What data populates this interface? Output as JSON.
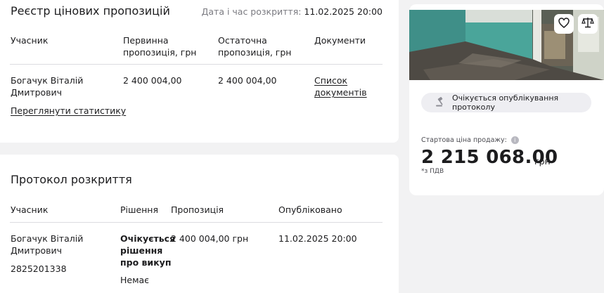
{
  "registry": {
    "title": "Реєстр цінових пропозицій",
    "date_label": "Дата і час розкриття:",
    "date_value": "11.02.2025 20:00",
    "headers": {
      "participant": "Учасник",
      "initial_line1": "Первинна",
      "initial_line2": "пропозиція, грн",
      "final_line1": "Остаточна",
      "final_line2": "пропозиція, грн",
      "documents": "Документи"
    },
    "row": {
      "name_line1": "Богачук Віталій",
      "name_line2": "Дмитрович",
      "initial": "2 400 004,00",
      "final": "2 400 004,00",
      "docs_line1": "Список",
      "docs_line2": "документів"
    },
    "stats_link": "Переглянути статистику"
  },
  "protocol": {
    "title": "Протокол розкриття",
    "headers": {
      "participant": "Учасник",
      "decision": "Рішення",
      "offer": "Пропозиція",
      "published": "Опубліковано"
    },
    "row": {
      "name_line1": "Богачук Віталій",
      "name_line2": "Дмитрович",
      "id": "2825201338",
      "decision_line1": "Очікується",
      "decision_line2": "рішення",
      "decision_line3": "про викуп",
      "offer": "2 400 004,00 грн",
      "published": "11.02.2025 20:00",
      "no": "Немає"
    }
  },
  "side": {
    "favorite_icon": "heart-icon",
    "compare_icon": "scales-icon",
    "status_icon": "gavel-icon",
    "status": "Очікується опублікування протоколу",
    "price_label": "Стартова ціна продажу:",
    "price": "2 215 068.00",
    "currency": "грн",
    "vat": "*з ПДВ"
  }
}
